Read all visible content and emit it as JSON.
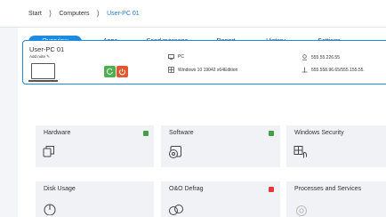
{
  "breadcrumb": {
    "items": [
      "Start",
      "Computers",
      "User-PC 01"
    ]
  },
  "tabs": [
    {
      "label": "Overview",
      "active": true
    },
    {
      "label": "Apps",
      "active": false
    },
    {
      "label": "Send message",
      "active": false
    },
    {
      "label": "Report",
      "active": false
    },
    {
      "label": "History",
      "active": false
    },
    {
      "label": "Settings",
      "active": false
    }
  ],
  "device": {
    "name": "User-PC 01",
    "add_note": "Add note",
    "type": "PC",
    "os": "Windows 10 19042 x64Edition",
    "ip": "555.55.226.55",
    "network": "555.558.96.65/555.155.55."
  },
  "tiles": [
    {
      "title": "Hardware",
      "status": "ok",
      "icon": "hardware-icon"
    },
    {
      "title": "Software",
      "status": "ok",
      "icon": "software-icon"
    },
    {
      "title": "Windows Security",
      "status": "",
      "icon": "windows-security-icon"
    },
    {
      "title": "Disk Usage",
      "status": "",
      "icon": "disk-usage-icon"
    },
    {
      "title": "O&O Defrag",
      "status": "error",
      "icon": "defrag-icon"
    },
    {
      "title": "Processes and Services",
      "status": "",
      "icon": "processes-icon"
    }
  ],
  "colors": {
    "accent": "#1f8be0",
    "ok": "#43a047",
    "error": "#e53935",
    "action_green": "#4caf50",
    "action_red": "#e4572e"
  }
}
